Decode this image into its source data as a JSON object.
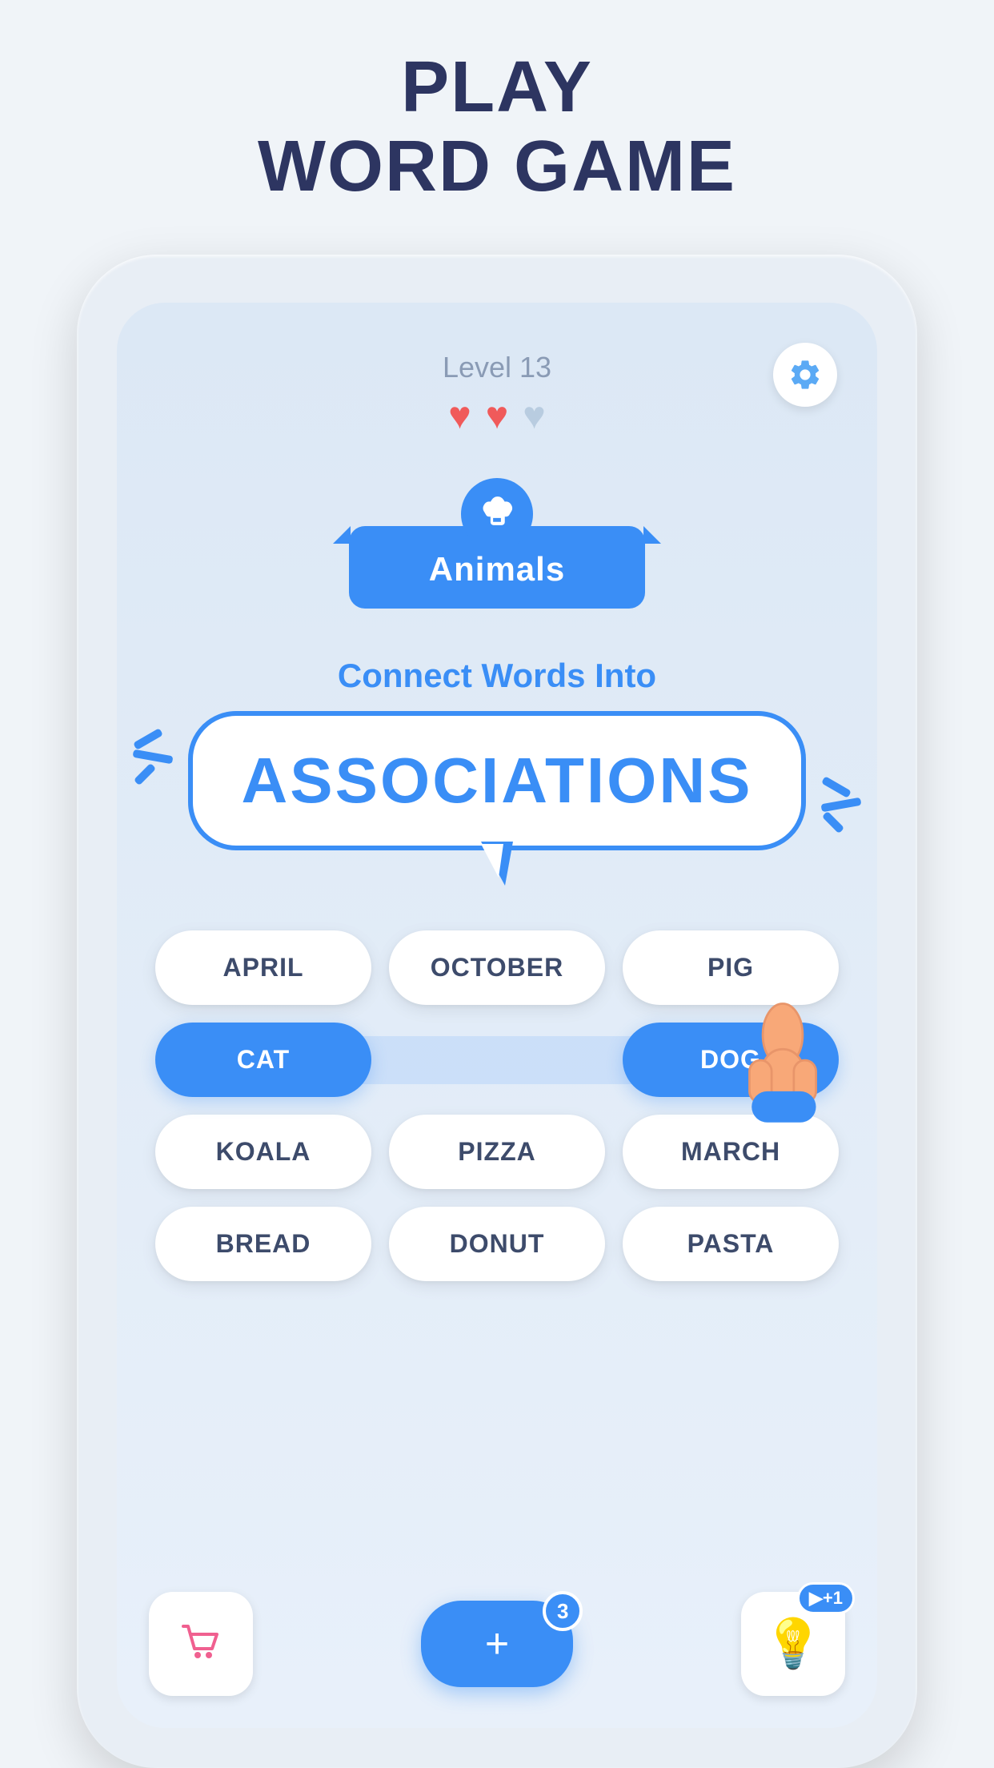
{
  "page": {
    "title_line1": "PLAY",
    "title_line2": "WORD GAME"
  },
  "game": {
    "level_label": "Level 13",
    "hearts": [
      {
        "active": true
      },
      {
        "active": true
      },
      {
        "active": false
      }
    ],
    "settings_icon": "gear-icon",
    "category": {
      "icon": "elephant-icon",
      "label": "Animals"
    },
    "connect_text": "Connect Words Into",
    "associations_label": "ASSOCIATIONS",
    "words": [
      [
        {
          "text": "APRIL",
          "selected": false
        },
        {
          "text": "OCTOBER",
          "selected": false
        },
        {
          "text": "PIG",
          "selected": false
        }
      ],
      [
        {
          "text": "CAT",
          "selected": true
        },
        {
          "text": "DOG",
          "selected": true
        }
      ],
      [
        {
          "text": "KOALA",
          "selected": false
        },
        {
          "text": "PIZZA",
          "selected": false
        },
        {
          "text": "MARCH",
          "selected": false
        }
      ],
      [
        {
          "text": "BREAD",
          "selected": false
        },
        {
          "text": "DONUT",
          "selected": false
        },
        {
          "text": "PASTA",
          "selected": false
        }
      ]
    ],
    "toolbar": {
      "shop_label": "shop",
      "add_label": "+",
      "add_count": "3",
      "hint_label": "💡",
      "hint_badge": "▶+1"
    }
  }
}
